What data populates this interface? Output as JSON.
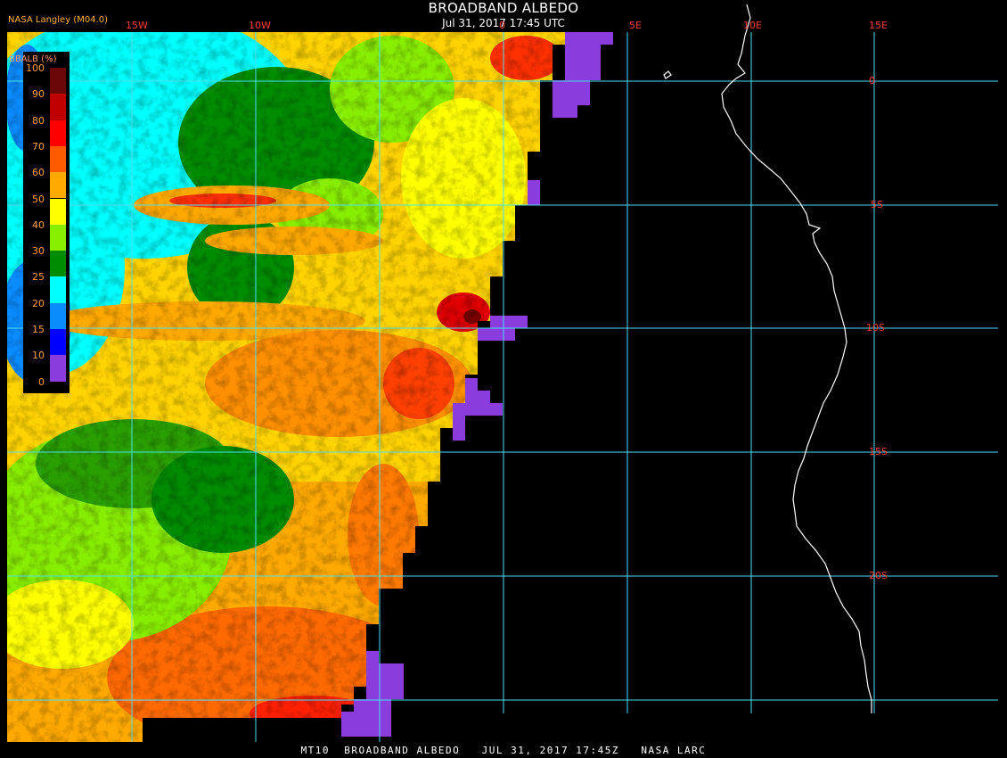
{
  "header": {
    "title": "BROADBAND ALBEDO",
    "subtitle": "Jul 31, 2017 17:45 UTC",
    "source": "NASA Langley (M04.0)"
  },
  "footer": {
    "caption": "MT10  BROADBAND ALBEDO   JUL 31, 2017 17:45Z   NASA LARC"
  },
  "legend": {
    "title": "BBALB (%)",
    "items": [
      {
        "label": "100",
        "color": "#6a0808"
      },
      {
        "label": "90",
        "color": "#c00000"
      },
      {
        "label": "80",
        "color": "#ff0000"
      },
      {
        "label": "70",
        "color": "#ff5a00"
      },
      {
        "label": "60",
        "color": "#ffaa00"
      },
      {
        "label": "50",
        "color": "#ffff00"
      },
      {
        "label": "40",
        "color": "#88ee00"
      },
      {
        "label": "30",
        "color": "#008c00"
      },
      {
        "label": "25",
        "color": "#00ffff"
      },
      {
        "label": "20",
        "color": "#0a8cff"
      },
      {
        "label": "15",
        "color": "#0000ff"
      },
      {
        "label": "10",
        "color": "#8a3cdc"
      },
      {
        "label": "0",
        "color": ""
      }
    ]
  },
  "grid": {
    "longitude_labels": [
      "15W",
      "10W",
      "0",
      "5E",
      "10E",
      "15E"
    ],
    "latitude_labels": [
      "0",
      "5S",
      "10S",
      "15S",
      "20S"
    ],
    "line_color": "#4ae0f0",
    "label_color": "#ff3a3a",
    "coastline_color": "#ffffff",
    "no_data_color": "#000000"
  }
}
